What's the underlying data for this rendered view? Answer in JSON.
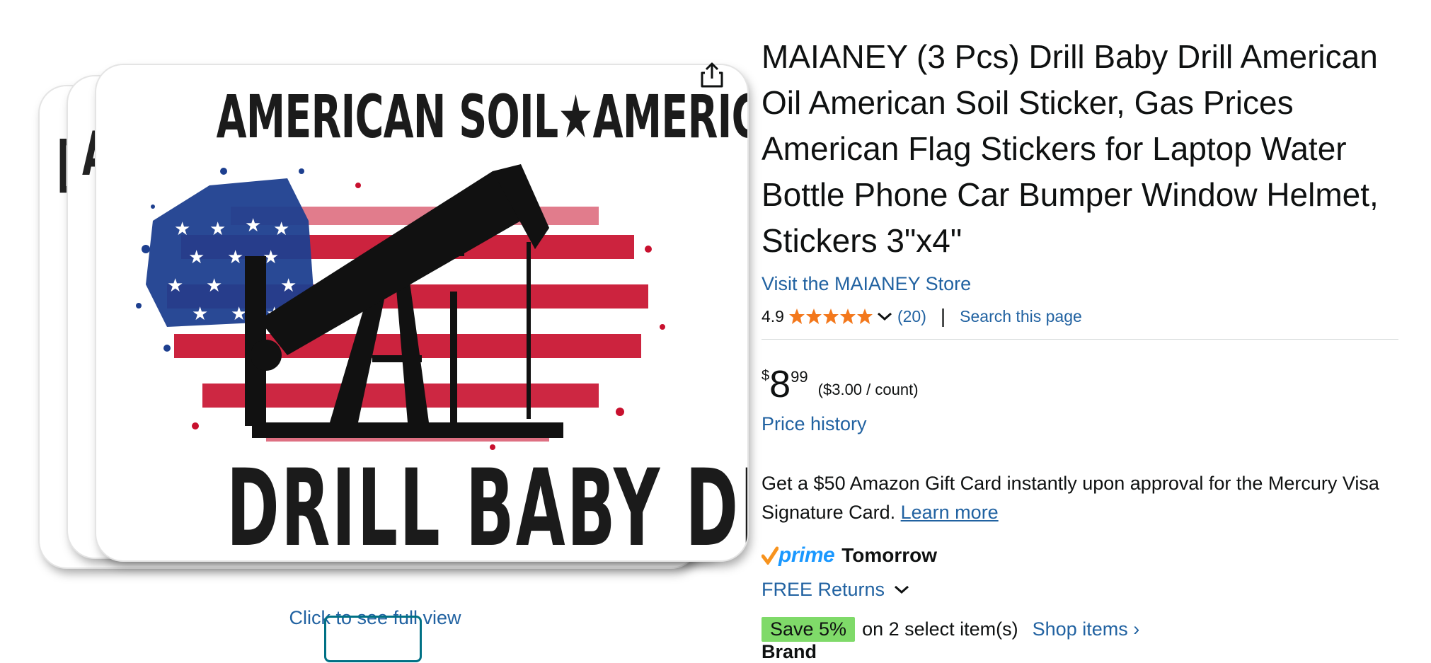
{
  "image": {
    "top_text": "AMERICAN SOIL★AMERICAN OIL",
    "bottom_text": "DRILL BABY DRILL",
    "full_view_label": "Click to see full view"
  },
  "product": {
    "title": "MAIANEY (3 Pcs) Drill Baby Drill American Oil American Soil Sticker, Gas Prices American Flag Stickers for Laptop Water Bottle Phone Car Bumper Window Helmet, Stickers 3\"x4\"",
    "store_link": "Visit the MAIANEY Store",
    "rating": "4.9",
    "stars": 5,
    "review_count": "(20)",
    "separator": "|",
    "search_link": "Search this page",
    "price": {
      "symbol": "$",
      "whole": "8",
      "fraction": "99",
      "unit_price": "($3.00 / count)"
    },
    "price_history": "Price history",
    "promo_text": "Get a $50 Amazon Gift Card instantly upon approval for the Mercury Visa Signature Card.",
    "learn_more": "Learn more",
    "prime_label": "prime",
    "delivery": "Tomorrow",
    "returns": "FREE Returns",
    "save_badge": "Save 5%",
    "save_text": "on 2 select item(s)",
    "shop_items": "Shop items ›",
    "brand_partial": "Brand"
  },
  "colors": {
    "link": "#2162a1",
    "save_badge": "#7fda69",
    "star": "#f3781c",
    "prime": "#1a98ff",
    "prime_check": "#f7931e",
    "flag_red": "#c8102e",
    "flag_blue": "#1d3f8f"
  },
  "icons": [
    "share-icon",
    "star-icon",
    "chevron-down-icon",
    "prime-check-icon"
  ]
}
